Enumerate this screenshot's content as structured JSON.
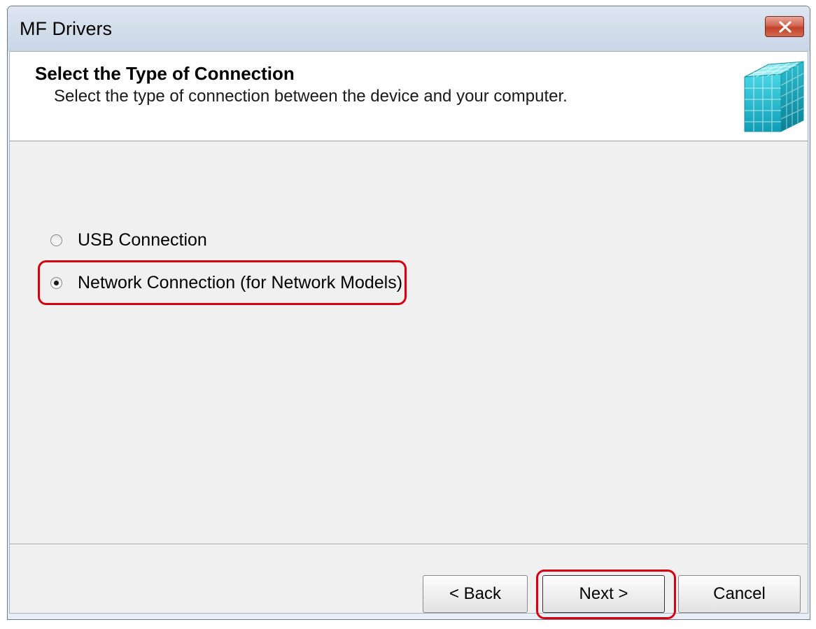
{
  "window": {
    "title": "MF Drivers",
    "close_icon": "close-icon"
  },
  "header": {
    "title": "Select the Type of Connection",
    "subtitle": "Select the type of connection between the device and your computer.",
    "logo_icon": "cube-logo-icon"
  },
  "options": [
    {
      "label": "USB Connection",
      "selected": false
    },
    {
      "label": "Network Connection (for Network Models)",
      "selected": true
    }
  ],
  "buttons": {
    "back": "< Back",
    "next": "Next >",
    "cancel": "Cancel"
  },
  "colors": {
    "highlight": "#d7000f",
    "logo_accent": "#2bbfd0"
  }
}
